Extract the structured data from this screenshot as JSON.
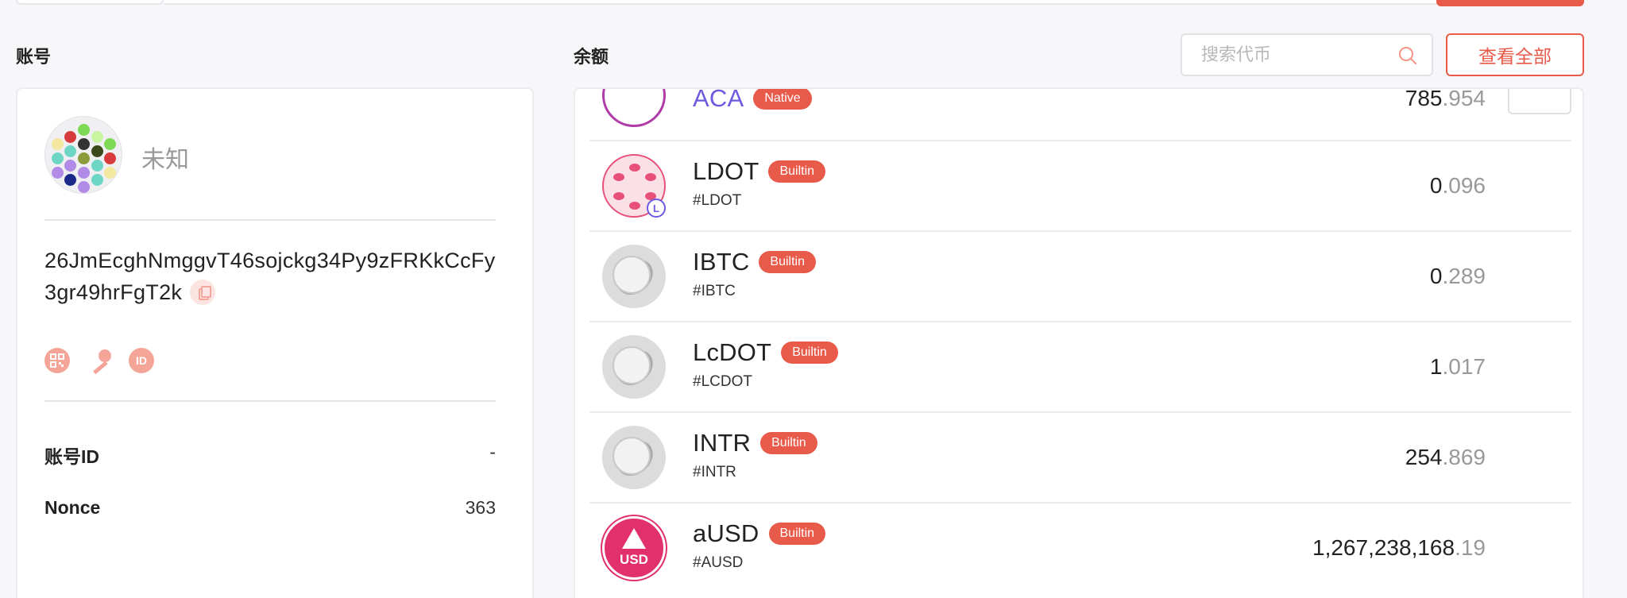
{
  "accounts_section": {
    "title": "账号"
  },
  "account": {
    "name": "未知",
    "address": "26JmEcghNmggvT46sojckg34Py9zFRKkCcFy3gr49hrFgT2k",
    "id_label": "账号ID",
    "id_value": "-",
    "nonce_label": "Nonce",
    "nonce_value": "363",
    "icons": [
      "qrcode-icon",
      "key-icon",
      "id-icon"
    ],
    "id_icon_text": "ID"
  },
  "balance_section": {
    "title": "余额",
    "search_placeholder": "搜索代币",
    "view_all_label": "查看全部"
  },
  "tokens": [
    {
      "name": "ACA",
      "badge": "Native",
      "symbol": "",
      "balance_int": "785",
      "balance_dec": ".954",
      "logo": "aca"
    },
    {
      "name": "LDOT",
      "badge": "Builtin",
      "symbol": "#LDOT",
      "balance_int": "0",
      "balance_dec": ".096",
      "logo": "ldot"
    },
    {
      "name": "IBTC",
      "badge": "Builtin",
      "symbol": "#IBTC",
      "balance_int": "0",
      "balance_dec": ".289",
      "logo": "gray"
    },
    {
      "name": "LcDOT",
      "badge": "Builtin",
      "symbol": "#LCDOT",
      "balance_int": "1",
      "balance_dec": ".017",
      "logo": "gray"
    },
    {
      "name": "INTR",
      "badge": "Builtin",
      "symbol": "#INTR",
      "balance_int": "254",
      "balance_dec": ".869",
      "logo": "gray"
    },
    {
      "name": "aUSD",
      "badge": "Builtin",
      "symbol": "#AUSD",
      "balance_int": "1,267,238,168",
      "balance_dec": ".19",
      "logo": "ausd",
      "logo_text": "USD"
    }
  ],
  "colors": {
    "accent": "#e85a4a",
    "badge_text": "#ffffff",
    "muted": "#999999"
  }
}
